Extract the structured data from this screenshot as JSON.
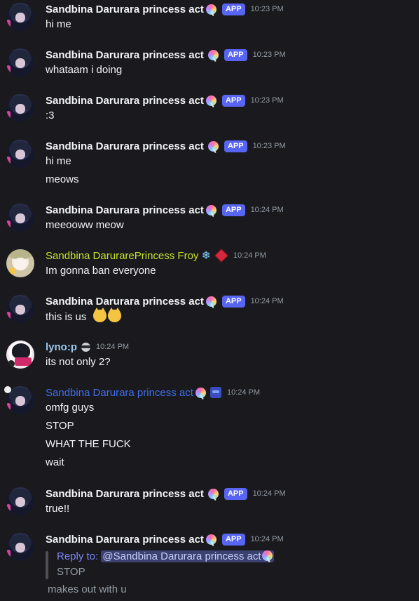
{
  "users": {
    "sandbina": "Sandbina Darurara princess act",
    "froy": "Sandbina DarurarePrincess Froy",
    "lyno": "lyno:p"
  },
  "app_badge": "APP",
  "icons": [
    "lollipop-icon",
    "snowflake-icon",
    "diamond-role-icon",
    "ninja-role-icon",
    "robot-role-icon",
    "cat-emoji"
  ],
  "messages": [
    {
      "user": "Sandbina Darurara princess act",
      "time": "10:23 PM",
      "lines": [
        "hi me"
      ]
    },
    {
      "user": "Sandbina Darurara princess act",
      "time": "10:23 PM",
      "lines": [
        "whataam i doing"
      ]
    },
    {
      "user": "Sandbina Darurara princess act",
      "time": "10:23 PM",
      "lines": [
        ":3"
      ]
    },
    {
      "user": "Sandbina Darurara princess act",
      "time": "10:23 PM",
      "lines": [
        "hi me",
        "meows"
      ]
    },
    {
      "user": "Sandbina Darurara princess act",
      "time": "10:24 PM",
      "lines": [
        "meeooww meow"
      ]
    },
    {
      "user": "Sandbina DarurarePrincess Froy",
      "time": "10:24 PM",
      "lines": [
        "Im gonna ban everyone"
      ]
    },
    {
      "user": "Sandbina Darurara princess act",
      "time": "10:24 PM",
      "lines": [
        "this is us"
      ]
    },
    {
      "user": "lyno:p",
      "time": "10:24 PM",
      "lines": [
        "its not only 2?"
      ]
    },
    {
      "user": "Sandbina Darurara princess act",
      "time": "10:24 PM",
      "lines": [
        "omfg guys",
        "STOP",
        "WHAT THE FUCK",
        "wait"
      ]
    },
    {
      "user": "Sandbina Darurara princess act",
      "time": "10:24 PM",
      "lines": [
        "true!!"
      ]
    },
    {
      "user": "Sandbina Darurara princess act",
      "time": "10:24 PM",
      "lines": [
        "makes out with u"
      ]
    }
  ],
  "reply": {
    "prefix": "Reply to:",
    "mention": "@Sandbina Darurara princess act",
    "quoted_text": "STOP"
  }
}
